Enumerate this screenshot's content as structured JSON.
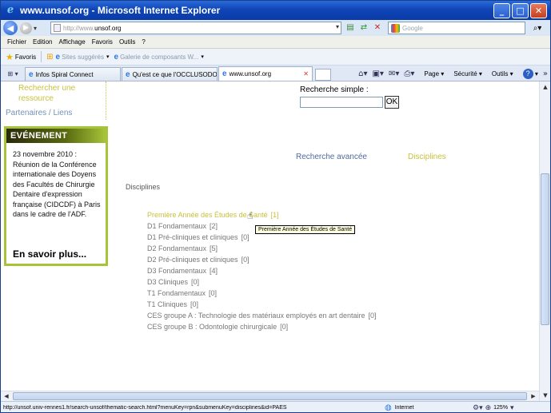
{
  "window": {
    "title": "www.unsof.org - Microsoft Internet Explorer",
    "minimize": "_",
    "maximize": "□",
    "close": "✕"
  },
  "address_bar": {
    "url_prefix": "http://www.",
    "url_domain": "unsof.org",
    "search_placeholder": "Google"
  },
  "menu": [
    "Fichier",
    "Edition",
    "Affichage",
    "Favoris",
    "Outils",
    "?"
  ],
  "favorites_bar": {
    "favorites_label": "Favoris",
    "suggested_sites": "Sites suggérés",
    "gallery": "Galerie de composants W..."
  },
  "tabs": [
    {
      "label": "Infos Spiral Connect",
      "active": false
    },
    {
      "label": "Qu'est ce que l'OCCLUSODO...",
      "active": false
    },
    {
      "label": "www.unsof.org",
      "active": true
    }
  ],
  "commands": {
    "page": "Page",
    "security": "Sécurité",
    "tools": "Outils"
  },
  "sidebar": {
    "search_resource": "Rechercher une ressource",
    "partners": "Partenaires / Liens",
    "event_heading": "EVÉNEMENT",
    "event_text": "23 novembre 2010 : Réunion de la Conférence internationale des Doyens des Facultés de Chirurgie Dentaire d'expression française (CIDCDF) à Paris dans le cadre de l'ADF.",
    "event_more": "En savoir plus..."
  },
  "search": {
    "label": "Recherche simple :",
    "button": "OK",
    "advanced": "Recherche avancée",
    "disciplines_link": "Disciplines"
  },
  "disciplines": {
    "title": "Disciplines",
    "items": [
      {
        "label": "Première Année des Études de Santé",
        "count": "[1]",
        "highlight": true
      },
      {
        "label": "D1 Fondamentaux",
        "count": "[2]"
      },
      {
        "label": "D1 Pré-cliniques et cliniques",
        "count": "[0]"
      },
      {
        "label": "D2 Fondamentaux",
        "count": "[5]"
      },
      {
        "label": "D2 Pré-cliniques et cliniques",
        "count": "[0]"
      },
      {
        "label": "D3 Fondamentaux",
        "count": "[4]"
      },
      {
        "label": "D3 Cliniques",
        "count": "[0]"
      },
      {
        "label": "T1 Fondamentaux",
        "count": "[0]"
      },
      {
        "label": "T1 Cliniques",
        "count": "[0]"
      },
      {
        "label": "CES groupe A : Technologie des matériaux employés en art dentaire",
        "count": "[0]"
      },
      {
        "label": "CES groupe B : Odontologie chirurgicale",
        "count": "[0]"
      }
    ],
    "tooltip": "Première Année des Études de Santé"
  },
  "status_bar": {
    "url": "http://unsof.univ-rennes1.fr/search-unsof/thematic-search.html?menuKey=rpn&submenuKey=disciplines&id=PAES",
    "zone": "Internet",
    "zoom": "125%"
  },
  "colors": {
    "accent_olive": "#c8c23c",
    "event_border": "#a6c43a",
    "link_blue": "#4d6b9a"
  }
}
